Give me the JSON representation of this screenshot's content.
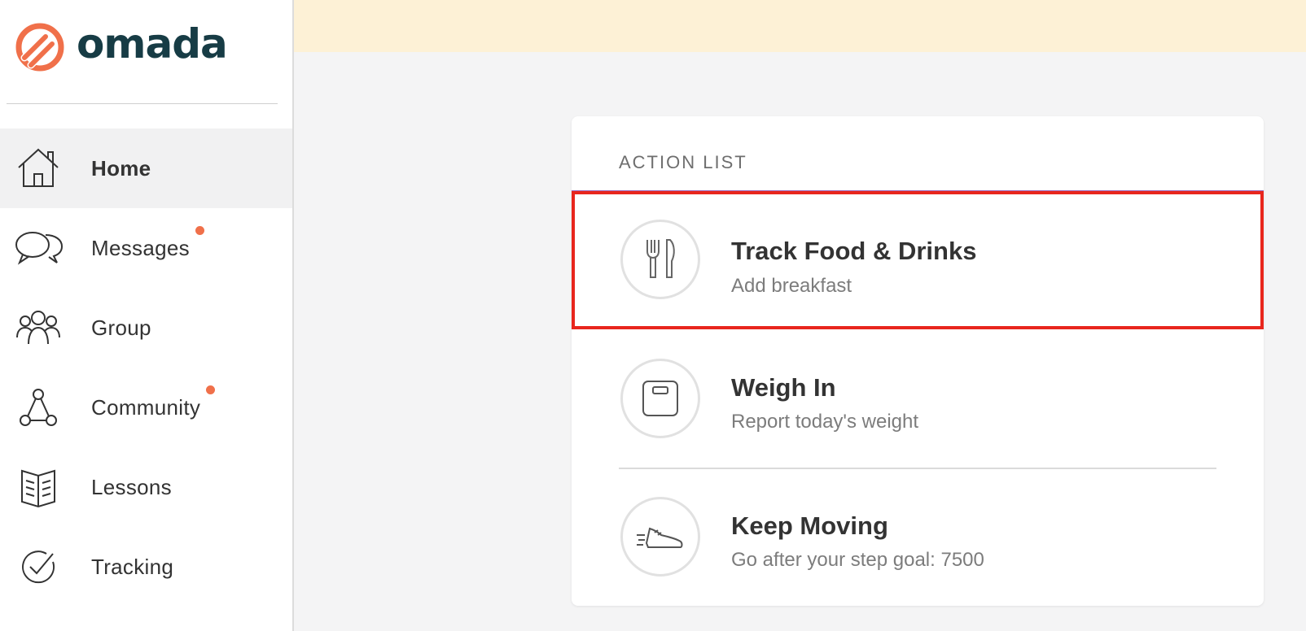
{
  "brand": {
    "name": "omada",
    "accent_color": "#f0704a",
    "text_color": "#173c45"
  },
  "sidebar": {
    "items": [
      {
        "label": "Home",
        "icon": "home-icon",
        "active": true,
        "notification": false
      },
      {
        "label": "Messages",
        "icon": "chat-bubbles-icon",
        "active": false,
        "notification": true
      },
      {
        "label": "Group",
        "icon": "people-group-icon",
        "active": false,
        "notification": false
      },
      {
        "label": "Community",
        "icon": "community-network-icon",
        "active": false,
        "notification": true
      },
      {
        "label": "Lessons",
        "icon": "book-icon",
        "active": false,
        "notification": false
      },
      {
        "label": "Tracking",
        "icon": "check-circle-icon",
        "active": false,
        "notification": false
      }
    ],
    "notification_color": "#f0704a"
  },
  "banner": {
    "color": "#fdf1d6"
  },
  "action_list": {
    "title": "ACTION LIST",
    "items": [
      {
        "title": "Track Food & Drinks",
        "subtitle": "Add breakfast",
        "icon": "fork-knife-icon",
        "highlighted": true
      },
      {
        "title": "Weigh In",
        "subtitle": "Report today's weight",
        "icon": "scale-icon",
        "highlighted": false
      },
      {
        "title": "Keep Moving",
        "subtitle": "Go after your step goal: 7500",
        "icon": "sneaker-icon",
        "highlighted": false
      }
    ],
    "highlight_color": "#e8261d"
  }
}
